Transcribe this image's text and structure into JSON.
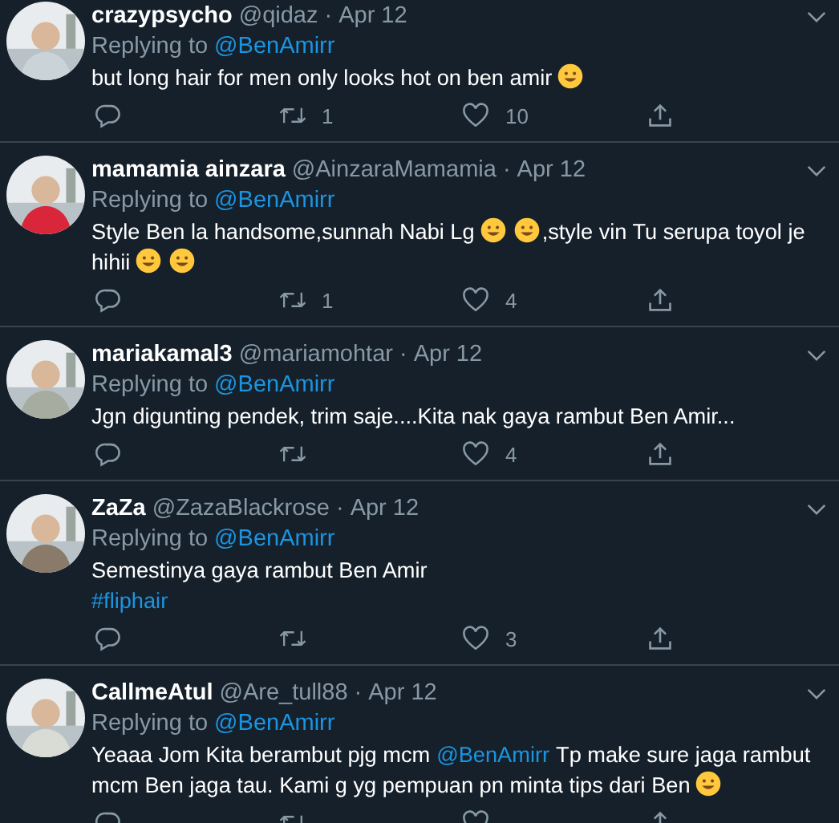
{
  "tweets": [
    {
      "name": "crazypsycho",
      "handle": "@qidaz",
      "separator": "·",
      "date": "Apr 12",
      "replying_label": "Replying to",
      "replying_to": "@BenAmirr",
      "body": [
        {
          "kind": "text",
          "text": "but long hair for men only looks hot on ben amir"
        },
        {
          "kind": "emoji"
        }
      ],
      "retweets": "1",
      "likes": "10"
    },
    {
      "name": "mamamia ainzara",
      "handle": "@AinzaraMamamia",
      "separator": "·",
      "date": "Apr 12",
      "replying_label": "Replying to",
      "replying_to": "@BenAmirr",
      "body": [
        {
          "kind": "text",
          "text": "Style Ben la handsome,sunnah Nabi Lg"
        },
        {
          "kind": "emoji"
        },
        {
          "kind": "emoji"
        },
        {
          "kind": "text",
          "text": ",style vin Tu serupa toyol je hihii"
        },
        {
          "kind": "emoji"
        },
        {
          "kind": "emoji"
        }
      ],
      "retweets": "1",
      "likes": "4"
    },
    {
      "name": "mariakamal3",
      "handle": "@mariamohtar",
      "separator": "·",
      "date": "Apr 12",
      "replying_label": "Replying to",
      "replying_to": "@BenAmirr",
      "body": [
        {
          "kind": "text",
          "text": "Jgn digunting pendek, trim saje....Kita nak gaya rambut Ben Amir..."
        }
      ],
      "likes": "4"
    },
    {
      "name": "ZaZa",
      "handle": "@ZazaBlackrose",
      "separator": "·",
      "date": "Apr 12",
      "replying_label": "Replying to",
      "replying_to": "@BenAmirr",
      "body": [
        {
          "kind": "text",
          "text": "Semestinya gaya rambut Ben Amir"
        },
        {
          "kind": "break"
        },
        {
          "kind": "hashtag",
          "text": "#fliphair"
        }
      ],
      "likes": "3"
    },
    {
      "name": "CallmeAtul",
      "handle": "@Are_tull88",
      "separator": "·",
      "date": "Apr 12",
      "replying_label": "Replying to",
      "replying_to": "@BenAmirr",
      "body": [
        {
          "kind": "text",
          "text": "Yeaaa Jom Kita berambut pjg mcm"
        },
        {
          "kind": "mention",
          "text": "@BenAmirr"
        },
        {
          "kind": "text",
          "text": "Tp make sure jaga rambut mcm Ben jaga tau. Kami g yg pempuan pn minta tips dari Ben"
        },
        {
          "kind": "emoji"
        }
      ]
    }
  ]
}
